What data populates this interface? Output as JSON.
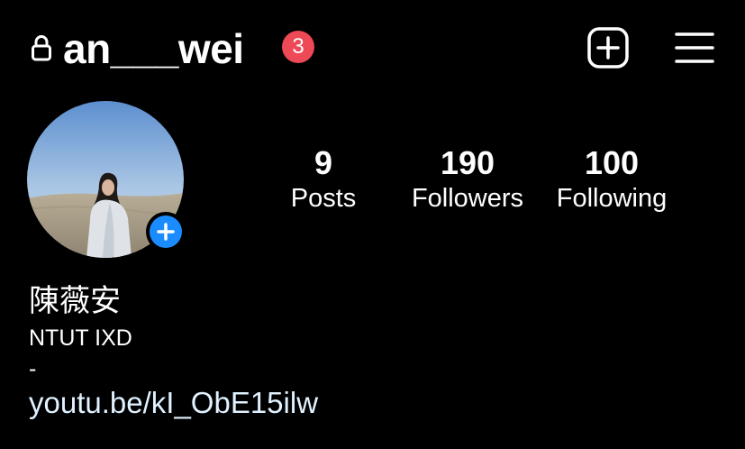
{
  "header": {
    "username": "an___wei",
    "notification_count": "3",
    "lock_icon": "lock-icon",
    "new_post_icon": "plus-square-icon",
    "menu_icon": "hamburger-menu-icon"
  },
  "profile": {
    "avatar_icon": "profile-photo",
    "add_story_icon": "plus-icon"
  },
  "stats": [
    {
      "value": "9",
      "label": "Posts"
    },
    {
      "value": "190",
      "label": "Followers"
    },
    {
      "value": "100",
      "label": "Following"
    }
  ],
  "bio": {
    "name": "陳薇安",
    "line1": "NTUT IXD",
    "line2": "-",
    "link": "youtu.be/kI_ObE15ilw"
  },
  "colors": {
    "background": "#000000",
    "text": "#ffffff",
    "badge": "#ed4956",
    "add_button": "#1a8cff",
    "link": "#e0f1ff"
  }
}
